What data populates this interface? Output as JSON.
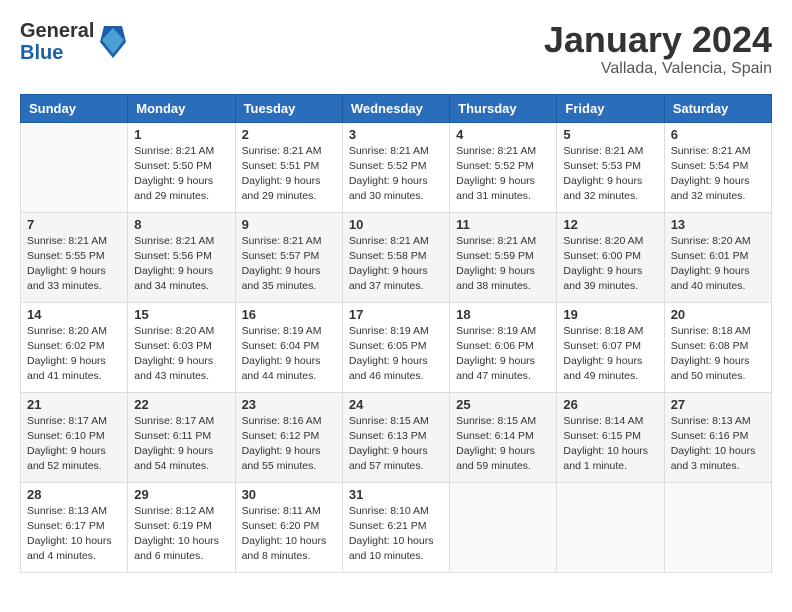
{
  "header": {
    "logo_general": "General",
    "logo_blue": "Blue",
    "month_year": "January 2024",
    "location": "Vallada, Valencia, Spain"
  },
  "weekdays": [
    "Sunday",
    "Monday",
    "Tuesday",
    "Wednesday",
    "Thursday",
    "Friday",
    "Saturday"
  ],
  "weeks": [
    [
      {
        "day": null
      },
      {
        "day": "1",
        "sunrise": "8:21 AM",
        "sunset": "5:50 PM",
        "daylight": "9 hours and 29 minutes."
      },
      {
        "day": "2",
        "sunrise": "8:21 AM",
        "sunset": "5:51 PM",
        "daylight": "9 hours and 29 minutes."
      },
      {
        "day": "3",
        "sunrise": "8:21 AM",
        "sunset": "5:52 PM",
        "daylight": "9 hours and 30 minutes."
      },
      {
        "day": "4",
        "sunrise": "8:21 AM",
        "sunset": "5:52 PM",
        "daylight": "9 hours and 31 minutes."
      },
      {
        "day": "5",
        "sunrise": "8:21 AM",
        "sunset": "5:53 PM",
        "daylight": "9 hours and 32 minutes."
      },
      {
        "day": "6",
        "sunrise": "8:21 AM",
        "sunset": "5:54 PM",
        "daylight": "9 hours and 32 minutes."
      }
    ],
    [
      {
        "day": "7",
        "sunrise": "8:21 AM",
        "sunset": "5:55 PM",
        "daylight": "9 hours and 33 minutes."
      },
      {
        "day": "8",
        "sunrise": "8:21 AM",
        "sunset": "5:56 PM",
        "daylight": "9 hours and 34 minutes."
      },
      {
        "day": "9",
        "sunrise": "8:21 AM",
        "sunset": "5:57 PM",
        "daylight": "9 hours and 35 minutes."
      },
      {
        "day": "10",
        "sunrise": "8:21 AM",
        "sunset": "5:58 PM",
        "daylight": "9 hours and 37 minutes."
      },
      {
        "day": "11",
        "sunrise": "8:21 AM",
        "sunset": "5:59 PM",
        "daylight": "9 hours and 38 minutes."
      },
      {
        "day": "12",
        "sunrise": "8:20 AM",
        "sunset": "6:00 PM",
        "daylight": "9 hours and 39 minutes."
      },
      {
        "day": "13",
        "sunrise": "8:20 AM",
        "sunset": "6:01 PM",
        "daylight": "9 hours and 40 minutes."
      }
    ],
    [
      {
        "day": "14",
        "sunrise": "8:20 AM",
        "sunset": "6:02 PM",
        "daylight": "9 hours and 41 minutes."
      },
      {
        "day": "15",
        "sunrise": "8:20 AM",
        "sunset": "6:03 PM",
        "daylight": "9 hours and 43 minutes."
      },
      {
        "day": "16",
        "sunrise": "8:19 AM",
        "sunset": "6:04 PM",
        "daylight": "9 hours and 44 minutes."
      },
      {
        "day": "17",
        "sunrise": "8:19 AM",
        "sunset": "6:05 PM",
        "daylight": "9 hours and 46 minutes."
      },
      {
        "day": "18",
        "sunrise": "8:19 AM",
        "sunset": "6:06 PM",
        "daylight": "9 hours and 47 minutes."
      },
      {
        "day": "19",
        "sunrise": "8:18 AM",
        "sunset": "6:07 PM",
        "daylight": "9 hours and 49 minutes."
      },
      {
        "day": "20",
        "sunrise": "8:18 AM",
        "sunset": "6:08 PM",
        "daylight": "9 hours and 50 minutes."
      }
    ],
    [
      {
        "day": "21",
        "sunrise": "8:17 AM",
        "sunset": "6:10 PM",
        "daylight": "9 hours and 52 minutes."
      },
      {
        "day": "22",
        "sunrise": "8:17 AM",
        "sunset": "6:11 PM",
        "daylight": "9 hours and 54 minutes."
      },
      {
        "day": "23",
        "sunrise": "8:16 AM",
        "sunset": "6:12 PM",
        "daylight": "9 hours and 55 minutes."
      },
      {
        "day": "24",
        "sunrise": "8:15 AM",
        "sunset": "6:13 PM",
        "daylight": "9 hours and 57 minutes."
      },
      {
        "day": "25",
        "sunrise": "8:15 AM",
        "sunset": "6:14 PM",
        "daylight": "9 hours and 59 minutes."
      },
      {
        "day": "26",
        "sunrise": "8:14 AM",
        "sunset": "6:15 PM",
        "daylight": "10 hours and 1 minute."
      },
      {
        "day": "27",
        "sunrise": "8:13 AM",
        "sunset": "6:16 PM",
        "daylight": "10 hours and 3 minutes."
      }
    ],
    [
      {
        "day": "28",
        "sunrise": "8:13 AM",
        "sunset": "6:17 PM",
        "daylight": "10 hours and 4 minutes."
      },
      {
        "day": "29",
        "sunrise": "8:12 AM",
        "sunset": "6:19 PM",
        "daylight": "10 hours and 6 minutes."
      },
      {
        "day": "30",
        "sunrise": "8:11 AM",
        "sunset": "6:20 PM",
        "daylight": "10 hours and 8 minutes."
      },
      {
        "day": "31",
        "sunrise": "8:10 AM",
        "sunset": "6:21 PM",
        "daylight": "10 hours and 10 minutes."
      },
      {
        "day": null
      },
      {
        "day": null
      },
      {
        "day": null
      }
    ]
  ],
  "labels": {
    "sunrise": "Sunrise:",
    "sunset": "Sunset:",
    "daylight": "Daylight:"
  }
}
